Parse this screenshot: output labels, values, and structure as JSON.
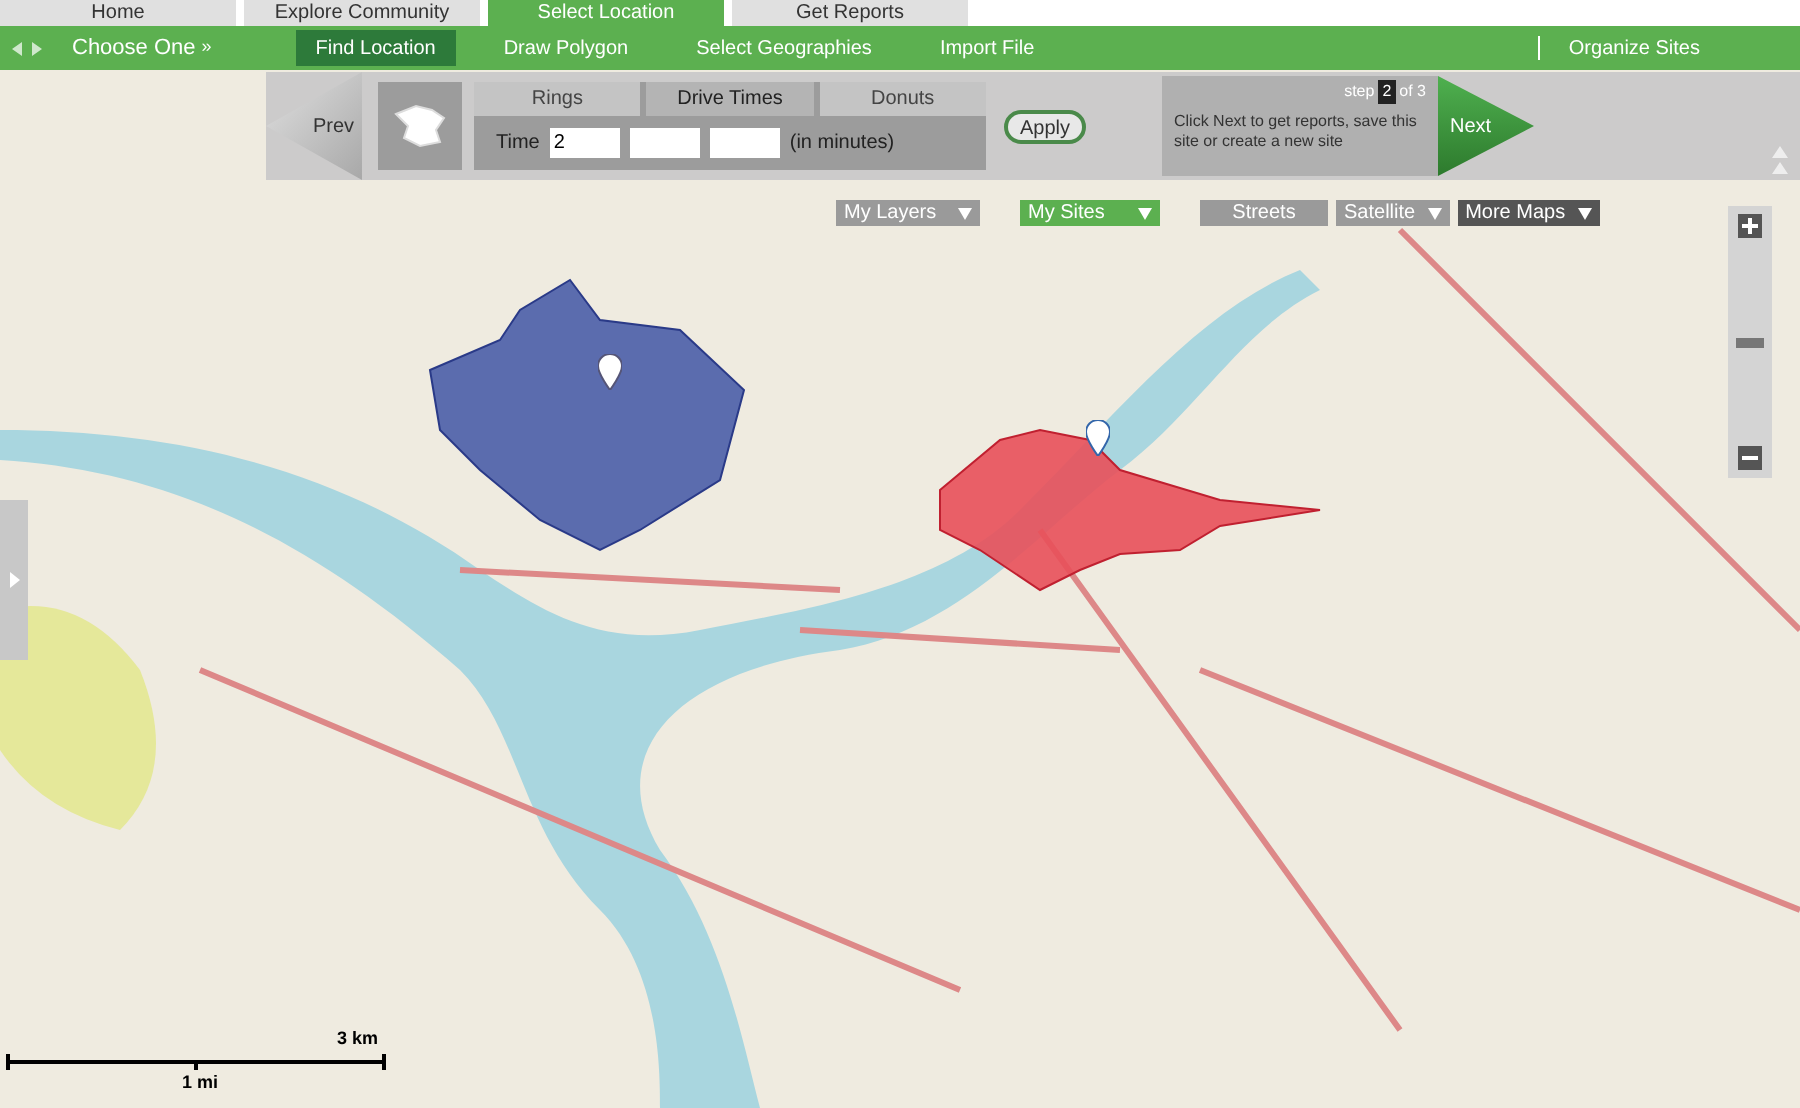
{
  "top_tabs": [
    {
      "label": "Home",
      "selected": false
    },
    {
      "label": "Explore Community",
      "selected": false
    },
    {
      "label": "Select Location",
      "selected": true
    },
    {
      "label": "Get Reports",
      "selected": false
    }
  ],
  "subnav": {
    "choose": "Choose One",
    "choose_arrows": "»",
    "items": [
      {
        "label": "Find Location",
        "selected": true
      },
      {
        "label": "Draw Polygon",
        "selected": false
      },
      {
        "label": "Select Geographies",
        "selected": false
      },
      {
        "label": "Import File",
        "selected": false
      }
    ],
    "right_link": "Organize Sites"
  },
  "toolbar": {
    "prev": "Prev",
    "mode_tabs": [
      {
        "label": "Rings",
        "selected": false
      },
      {
        "label": "Drive Times",
        "selected": true
      },
      {
        "label": "Donuts",
        "selected": false
      }
    ],
    "time_label": "Time",
    "time_fields": [
      {
        "kind": "input",
        "value": "2"
      },
      {
        "kind": "input"
      },
      {
        "kind": "input"
      }
    ],
    "unit": "(in minutes)",
    "apply": "Apply",
    "step_word": "step",
    "step_current": "2",
    "step_total": "of 3",
    "hint": "Click Next to get reports, save this site or create a new site",
    "next": "Next"
  },
  "map_layers": [
    {
      "label": "My Layers",
      "selected": false,
      "has_menu": true
    },
    {
      "label": "My Sites",
      "selected": true,
      "has_menu": true
    },
    {
      "label": "Streets",
      "selected": false,
      "has_menu": false
    },
    {
      "label": "Satellite",
      "selected": false,
      "has_menu": true
    },
    {
      "label": "More Maps",
      "selected": false,
      "has_menu": true
    }
  ],
  "scale": {
    "miles": "1 mi",
    "km": "3 km"
  }
}
